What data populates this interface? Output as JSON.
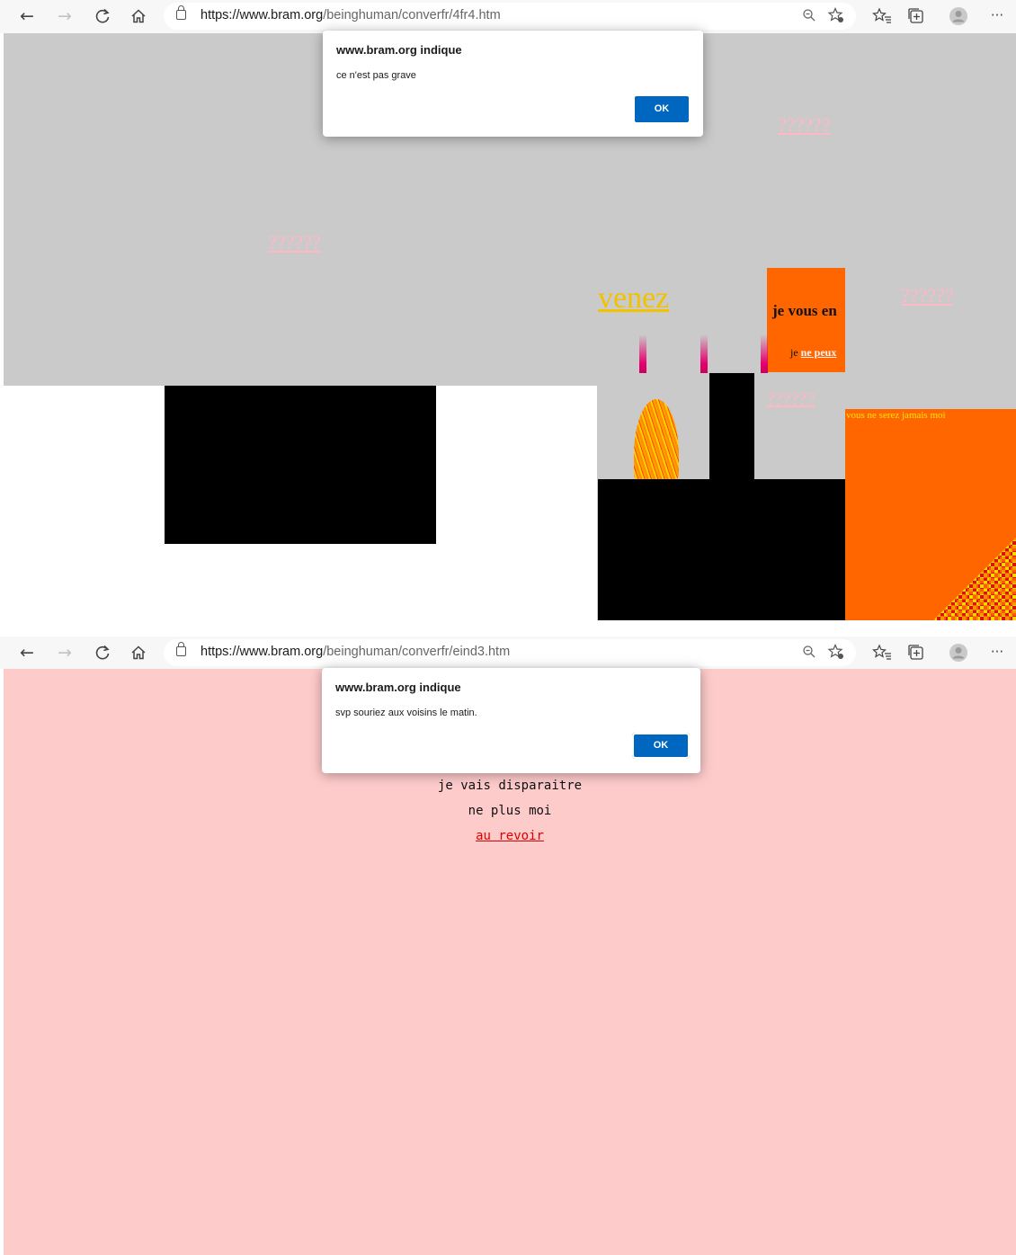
{
  "windows": [
    {
      "url_host": "https://www.bram.org",
      "url_path": "/beinghuman/converfr/4fr4.htm",
      "dialog": {
        "title": "www.bram.org indique",
        "message": "ce n'est pas grave",
        "ok_label": "OK"
      },
      "page": {
        "question_marks": "??????",
        "venez": "venez",
        "je_vous_en": "je vous en",
        "je": "je",
        "ne_peux": "ne peux",
        "vous_ne_serez": "vous ne serez jamais moi"
      }
    },
    {
      "url_host": "https://www.bram.org",
      "url_path": "/beinghuman/converfr/eind3.htm",
      "dialog": {
        "title": "www.bram.org indique",
        "message": "svp souriez aux voisins le matin.",
        "ok_label": "OK"
      },
      "page": {
        "line1": "je vais disparaitre",
        "line2": "ne plus moi",
        "link": "au revoir"
      }
    }
  ],
  "colors": {
    "page1_bg": "#cacaca",
    "orange": "#ff6600",
    "venez_yellow": "#f2c200",
    "question_pink": "#ffb8c6",
    "page2_bg": "#fecbcb",
    "ok_blue": "#0067c0"
  },
  "icons": [
    "back-icon",
    "forward-icon",
    "refresh-icon",
    "home-icon",
    "lock-icon",
    "zoom-icon",
    "favorite-add-icon",
    "favorites-icon",
    "collections-icon",
    "profile-icon",
    "more-icon"
  ]
}
